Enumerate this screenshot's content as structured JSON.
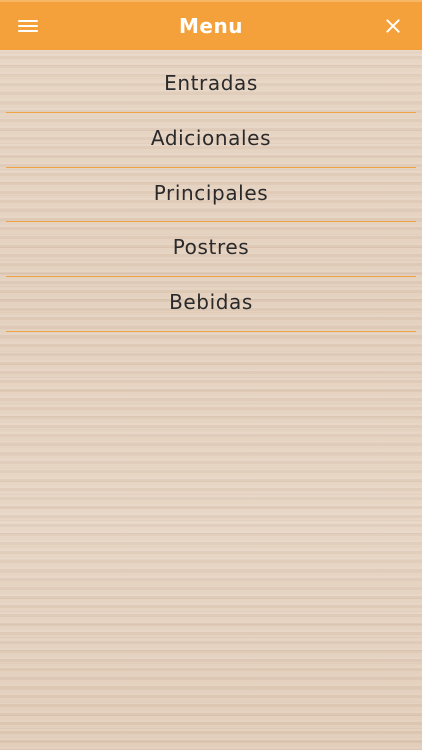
{
  "header": {
    "title": "Menu",
    "menu_icon": "hamburger-icon",
    "close_icon": "close-icon",
    "accent_color": "#f4a13c"
  },
  "menu": {
    "items": [
      {
        "label": "Entradas"
      },
      {
        "label": "Adicionales"
      },
      {
        "label": "Principales"
      },
      {
        "label": "Postres"
      },
      {
        "label": "Bebidas"
      }
    ],
    "divider_color": "#f0a346"
  }
}
